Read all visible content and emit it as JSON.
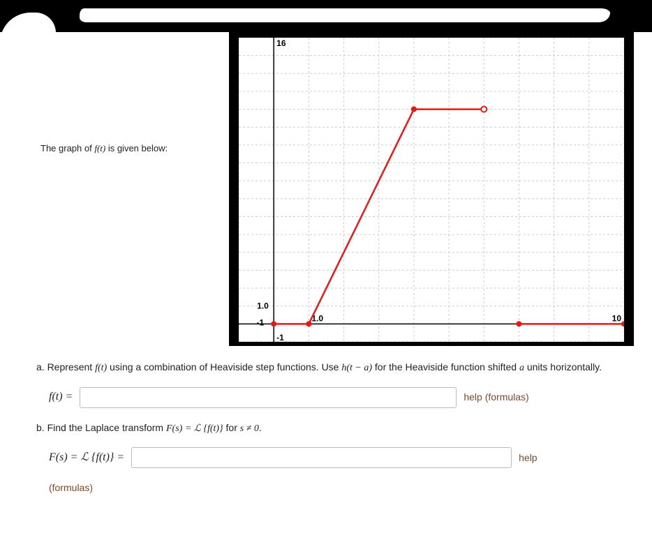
{
  "prompt": {
    "intro_pre": "The graph of ",
    "intro_fn": "f(t)",
    "intro_post": " is given below:"
  },
  "chart_data": {
    "type": "line",
    "xlim": [
      -1,
      10
    ],
    "ylim": [
      -1,
      16
    ],
    "x_ticks": [
      "-1",
      "1.0",
      "10"
    ],
    "y_ticks": [
      "-1",
      "1.0",
      "16"
    ],
    "segments": [
      {
        "from": [
          0,
          0
        ],
        "to": [
          1,
          0
        ],
        "closed_start": true,
        "closed_end": true
      },
      {
        "from": [
          1,
          0
        ],
        "to": [
          4,
          12
        ],
        "closed_start": true,
        "closed_end": true
      },
      {
        "from": [
          4,
          12
        ],
        "to": [
          6,
          12
        ],
        "closed_start": true,
        "closed_end": false
      },
      {
        "from": [
          7,
          0
        ],
        "to": [
          10,
          0
        ],
        "closed_start": true,
        "closed_end": true
      }
    ]
  },
  "q_a": {
    "text_pre": "a. Represent ",
    "fn1": "f(t)",
    "text_mid1": " using a combination of Heaviside step functions. Use ",
    "fn2": "h(t − a)",
    "text_mid2": " for the Heaviside function shifted ",
    "var_a": "a",
    "text_post": " units horizontally.",
    "label": "f(t) =",
    "help": "help (formulas)",
    "value": ""
  },
  "q_b": {
    "text_pre": "b. Find the Laplace transform ",
    "fn1": "F(s) = ℒ {f(t)}",
    "text_mid": " for ",
    "cond": "s ≠ 0",
    "text_post": ".",
    "label": "F(s) = ℒ {f(t)} =",
    "help": "help",
    "formulas_text": "(formulas)",
    "value": ""
  }
}
